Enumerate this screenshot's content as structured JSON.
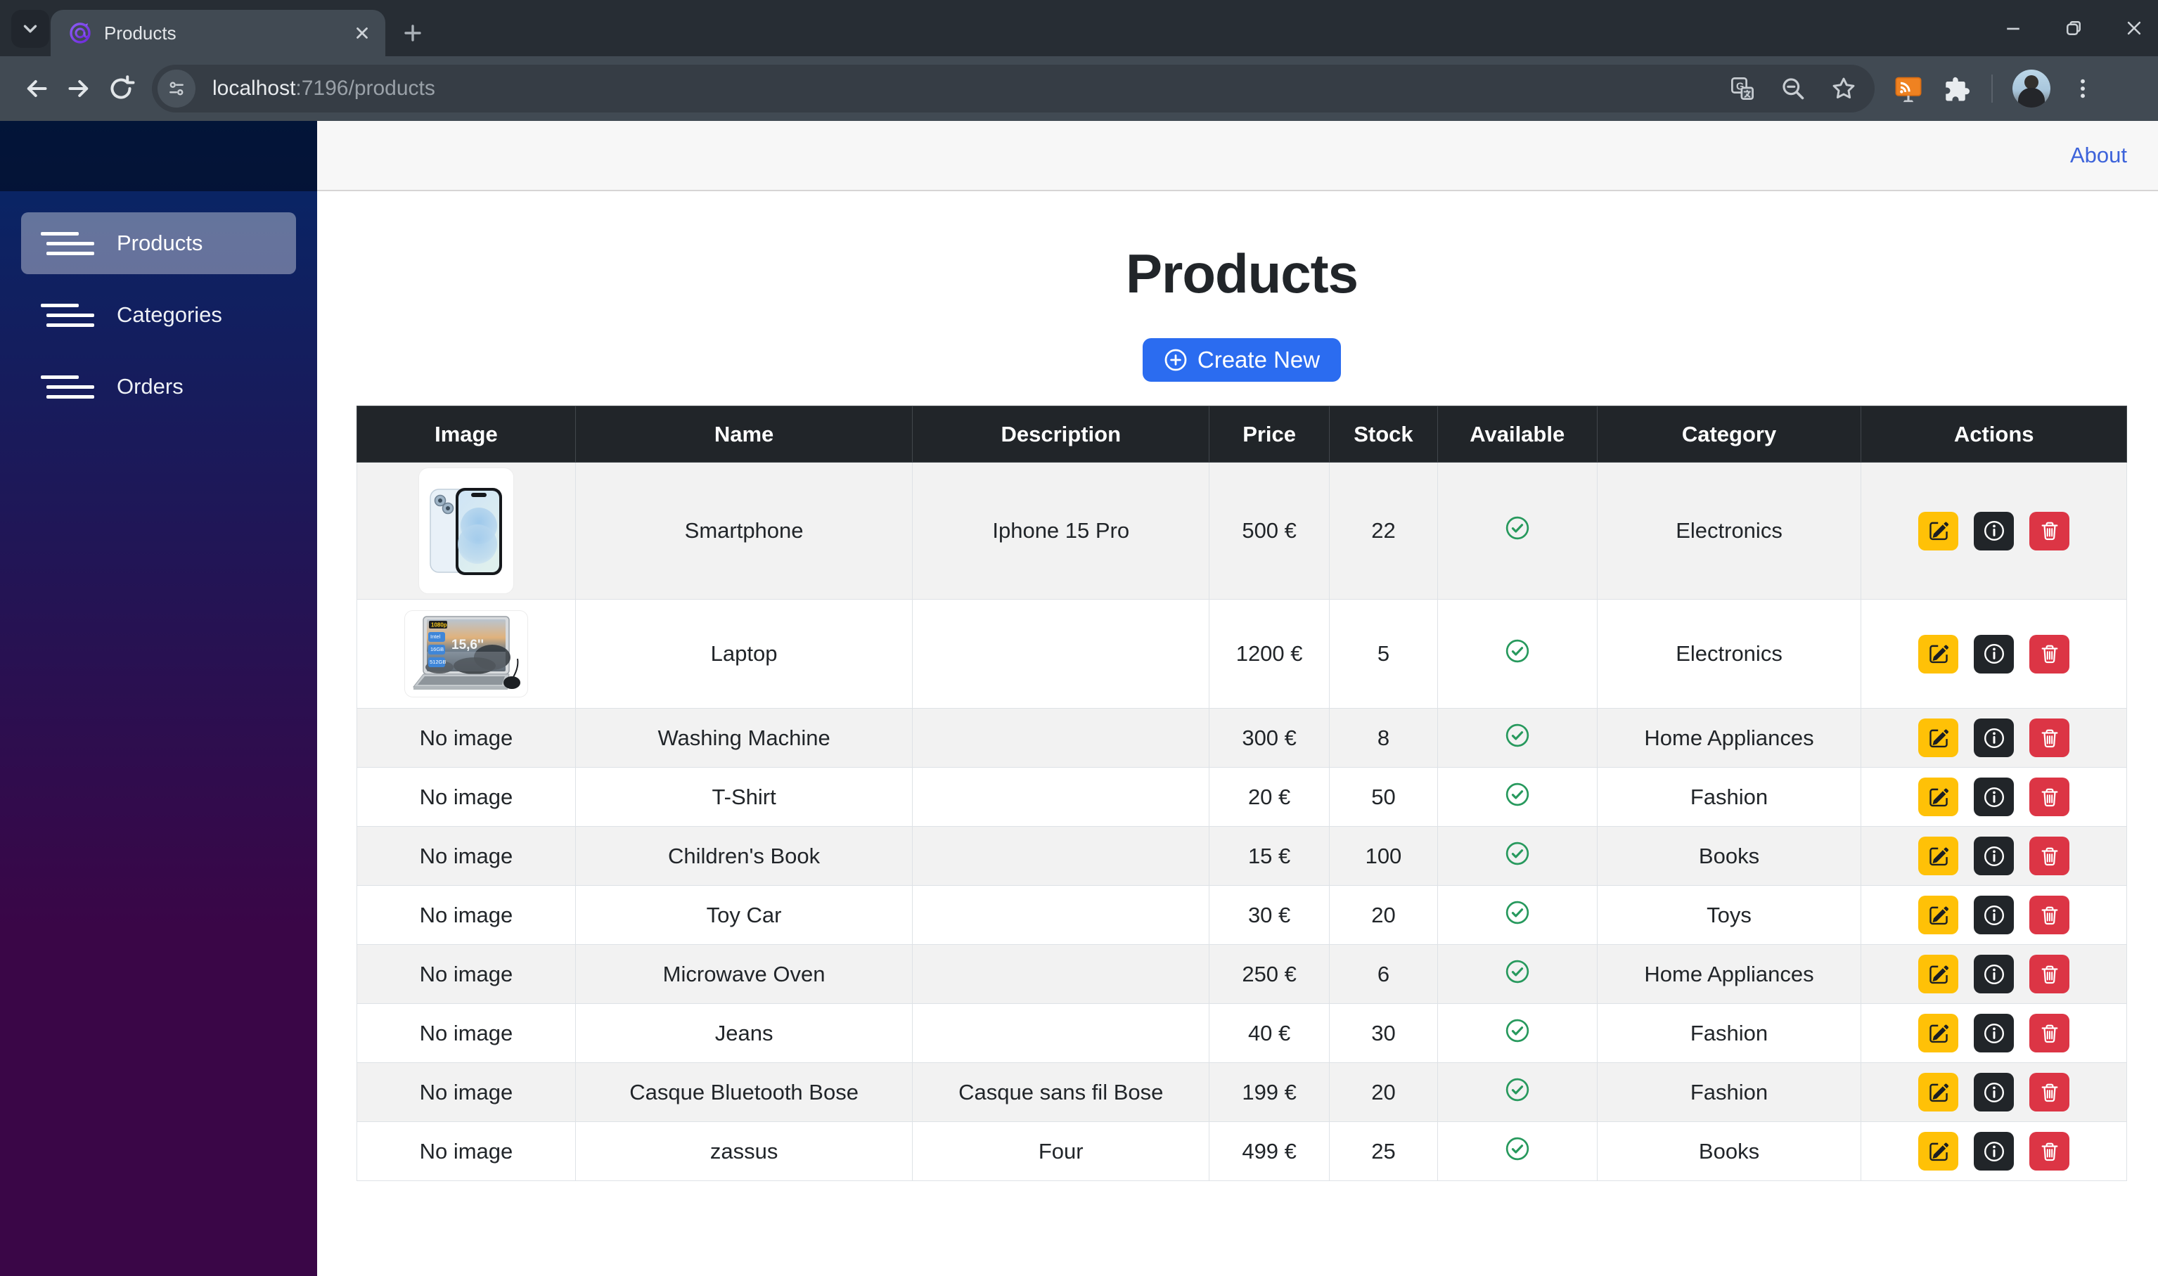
{
  "browser": {
    "tab_title": "Products",
    "url_host": "localhost",
    "url_rest": ":7196/products"
  },
  "topbar": {
    "about_label": "About"
  },
  "sidebar": {
    "items": [
      {
        "label": "Products",
        "active": true
      },
      {
        "label": "Categories",
        "active": false
      },
      {
        "label": "Orders",
        "active": false
      }
    ]
  },
  "main": {
    "title": "Products",
    "create_button_label": "Create New"
  },
  "colors": {
    "sidebar_gradient_top": "#052767",
    "sidebar_gradient_bottom": "#3a0647",
    "primary_button": "#2b6cf0",
    "table_header_bg": "#212529",
    "stripe_bg": "#f2f2f2",
    "available_green": "#27995d",
    "edit_yellow": "#ffc107",
    "info_dark": "#212529",
    "delete_red": "#dc3545",
    "about_link": "#3d63da"
  },
  "table": {
    "headers": [
      "Image",
      "Name",
      "Description",
      "Price",
      "Stock",
      "Available",
      "Category",
      "Actions"
    ],
    "no_image_label": "No image",
    "action_icons": [
      "edit",
      "details",
      "delete"
    ],
    "rows": [
      {
        "image": "iphone-15",
        "name": "Smartphone",
        "description": "Iphone 15 Pro",
        "price": "500 €",
        "stock": "22",
        "available": true,
        "category": "Electronics"
      },
      {
        "image": "laptop",
        "name": "Laptop",
        "description": "",
        "price": "1200 €",
        "stock": "5",
        "available": true,
        "category": "Electronics"
      },
      {
        "image": "none",
        "name": "Washing Machine",
        "description": "",
        "price": "300 €",
        "stock": "8",
        "available": true,
        "category": "Home Appliances"
      },
      {
        "image": "none",
        "name": "T-Shirt",
        "description": "",
        "price": "20 €",
        "stock": "50",
        "available": true,
        "category": "Fashion"
      },
      {
        "image": "none",
        "name": "Children's Book",
        "description": "",
        "price": "15 €",
        "stock": "100",
        "available": true,
        "category": "Books"
      },
      {
        "image": "none",
        "name": "Toy Car",
        "description": "",
        "price": "30 €",
        "stock": "20",
        "available": true,
        "category": "Toys"
      },
      {
        "image": "none",
        "name": "Microwave Oven",
        "description": "",
        "price": "250 €",
        "stock": "6",
        "available": true,
        "category": "Home Appliances"
      },
      {
        "image": "none",
        "name": "Jeans",
        "description": "",
        "price": "40 €",
        "stock": "30",
        "available": true,
        "category": "Fashion"
      },
      {
        "image": "none",
        "name": "Casque Bluetooth Bose",
        "description": "Casque sans fil Bose",
        "price": "199 €",
        "stock": "20",
        "available": true,
        "category": "Fashion"
      },
      {
        "image": "none",
        "name": "zassus",
        "description": "Four",
        "price": "499 €",
        "stock": "25",
        "available": true,
        "category": "Books"
      }
    ]
  }
}
